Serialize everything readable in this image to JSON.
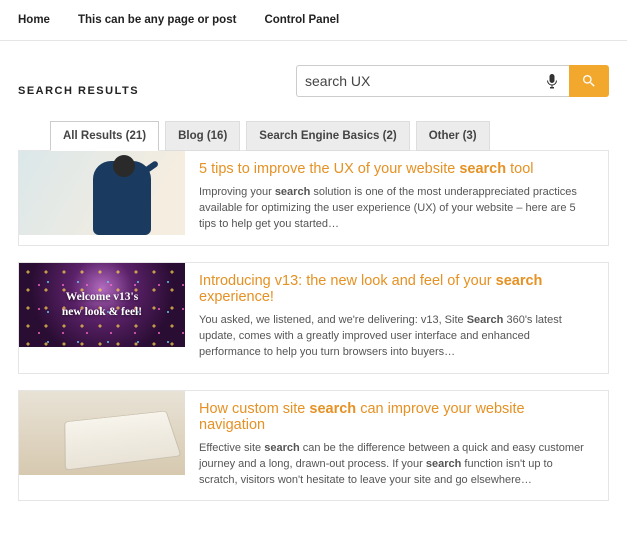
{
  "nav": {
    "items": [
      {
        "label": "Home"
      },
      {
        "label": "This can be any page or post"
      },
      {
        "label": "Control Panel"
      }
    ]
  },
  "heading": "SEARCH RESULTS",
  "search": {
    "value": "search UX",
    "placeholder": ""
  },
  "tabs": [
    {
      "label": "All Results (21)",
      "active": true
    },
    {
      "label": "Blog (16)",
      "active": false
    },
    {
      "label": "Search Engine Basics (2)",
      "active": false
    },
    {
      "label": "Other (3)",
      "active": false
    }
  ],
  "results": [
    {
      "title_pre": "5 tips to improve the UX of your website ",
      "title_bold": "search",
      "title_post": " tool",
      "snippet_pre": "Improving your ",
      "snippet_bold": "search",
      "snippet_post": " solution is one of the most underappreciated practices available for optimizing the user experience (UX) of your website – here are 5 tips to help get you started…"
    },
    {
      "thumb_overlay": "Welcome v13's\nnew look & feel!",
      "title_pre": "Introducing v13: the new look and feel of your ",
      "title_bold": "search",
      "title_post": " experience!",
      "snippet_pre": "You asked, we listened, and we're delivering: v13, Site ",
      "snippet_bold": "Search",
      "snippet_post": " 360's latest update, comes with a greatly improved user interface and enhanced performance to help you turn browsers into buyers…"
    },
    {
      "title_pre": "How custom site ",
      "title_bold": "search",
      "title_post": " can improve your website navigation",
      "snippet_a": "Effective site ",
      "snippet_b": "search",
      "snippet_c": " can be the difference between a quick and easy customer journey and a long, drawn-out process. If your ",
      "snippet_d": "search",
      "snippet_e": " function isn't up to scratch, visitors won't hesitate to leave your site and go elsewhere…"
    }
  ]
}
